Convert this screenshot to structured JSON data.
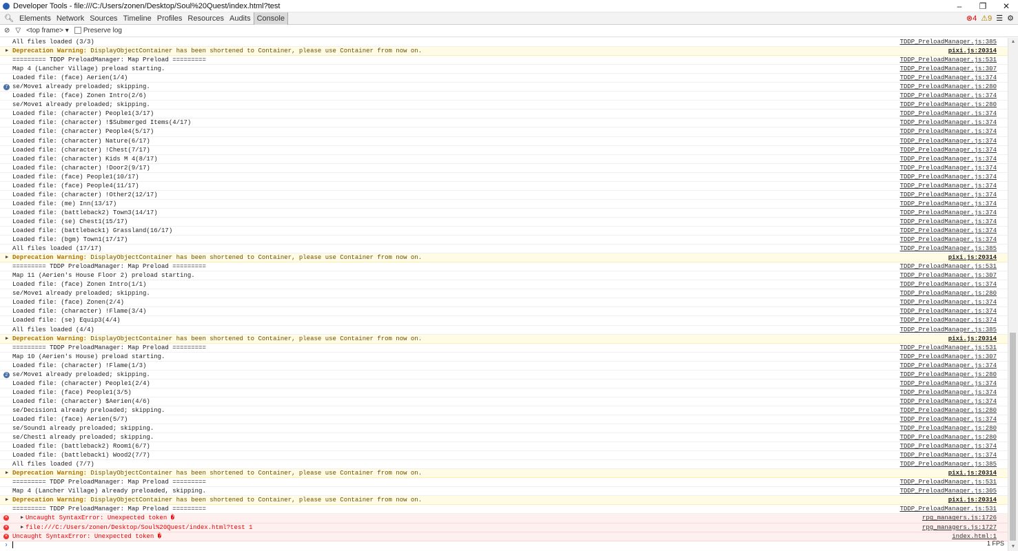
{
  "window": {
    "title": "Developer Tools - file:///C:/Users/zonen/Desktop/Soul%20Quest/index.html?test",
    "minimize": "–",
    "restore": "❐",
    "close": "✕"
  },
  "tabs": [
    "Elements",
    "Network",
    "Sources",
    "Timeline",
    "Profiles",
    "Resources",
    "Audits",
    "Console"
  ],
  "status": {
    "errors": "4",
    "warnings": "9"
  },
  "toolbar": {
    "frame": "<top frame>",
    "preserve_log": "Preserve log"
  },
  "rows": [
    {
      "type": "log",
      "msg": "All files loaded (3/3)",
      "src": "TDDP_PreloadManager.js:385"
    },
    {
      "type": "warn",
      "label": "Deprecation Warning:",
      "msg": " DisplayObjectContainer has been shortened to Container, please use Container from now on.",
      "src": "pixi.js:20314"
    },
    {
      "type": "log",
      "msg": "========= TDDP PreloadManager: Map Preload =========",
      "src": "TDDP_PreloadManager.js:531"
    },
    {
      "type": "log",
      "msg": "Map 4 (Lancher Village) preload starting.",
      "src": "TDDP_PreloadManager.js:307"
    },
    {
      "type": "log",
      "msg": "Loaded file: (face) Aerien(1/4)",
      "src": "TDDP_PreloadManager.js:374"
    },
    {
      "type": "log",
      "badge": "7",
      "msg": "se/Move1 already preloaded; skipping.",
      "src": "TDDP_PreloadManager.js:280"
    },
    {
      "type": "log",
      "msg": "Loaded file: (face) Zonen Intro(2/6)",
      "src": "TDDP_PreloadManager.js:374"
    },
    {
      "type": "log",
      "msg": "se/Move1 already preloaded; skipping.",
      "src": "TDDP_PreloadManager.js:280"
    },
    {
      "type": "log",
      "msg": "Loaded file: (character) People1(3/17)",
      "src": "TDDP_PreloadManager.js:374"
    },
    {
      "type": "log",
      "msg": "Loaded file: (character) !$Submerged Items(4/17)",
      "src": "TDDP_PreloadManager.js:374"
    },
    {
      "type": "log",
      "msg": "Loaded file: (character) People4(5/17)",
      "src": "TDDP_PreloadManager.js:374"
    },
    {
      "type": "log",
      "msg": "Loaded file: (character) Nature(6/17)",
      "src": "TDDP_PreloadManager.js:374"
    },
    {
      "type": "log",
      "msg": "Loaded file: (character) !Chest(7/17)",
      "src": "TDDP_PreloadManager.js:374"
    },
    {
      "type": "log",
      "msg": "Loaded file: (character) Kids M 4(8/17)",
      "src": "TDDP_PreloadManager.js:374"
    },
    {
      "type": "log",
      "msg": "Loaded file: (character) !Door2(9/17)",
      "src": "TDDP_PreloadManager.js:374"
    },
    {
      "type": "log",
      "msg": "Loaded file: (face) People1(10/17)",
      "src": "TDDP_PreloadManager.js:374"
    },
    {
      "type": "log",
      "msg": "Loaded file: (face) People4(11/17)",
      "src": "TDDP_PreloadManager.js:374"
    },
    {
      "type": "log",
      "msg": "Loaded file: (character) !Other2(12/17)",
      "src": "TDDP_PreloadManager.js:374"
    },
    {
      "type": "log",
      "msg": "Loaded file: (me) Inn(13/17)",
      "src": "TDDP_PreloadManager.js:374"
    },
    {
      "type": "log",
      "msg": "Loaded file: (battleback2) Town3(14/17)",
      "src": "TDDP_PreloadManager.js:374"
    },
    {
      "type": "log",
      "msg": "Loaded file: (se) Chest1(15/17)",
      "src": "TDDP_PreloadManager.js:374"
    },
    {
      "type": "log",
      "msg": "Loaded file: (battleback1) Grassland(16/17)",
      "src": "TDDP_PreloadManager.js:374"
    },
    {
      "type": "log",
      "msg": "Loaded file: (bgm) Town1(17/17)",
      "src": "TDDP_PreloadManager.js:374"
    },
    {
      "type": "log",
      "msg": "All files loaded (17/17)",
      "src": "TDDP_PreloadManager.js:385"
    },
    {
      "type": "warn",
      "label": "Deprecation Warning:",
      "msg": " DisplayObjectContainer has been shortened to Container, please use Container from now on.",
      "src": "pixi.js:20314"
    },
    {
      "type": "log",
      "msg": "========= TDDP PreloadManager: Map Preload =========",
      "src": "TDDP_PreloadManager.js:531"
    },
    {
      "type": "log",
      "msg": "Map 11 (Aerien's House Floor 2) preload starting.",
      "src": "TDDP_PreloadManager.js:307"
    },
    {
      "type": "log",
      "msg": "Loaded file: (face) Zonen Intro(1/1)",
      "src": "TDDP_PreloadManager.js:374"
    },
    {
      "type": "log",
      "msg": "se/Move1 already preloaded; skipping.",
      "src": "TDDP_PreloadManager.js:280"
    },
    {
      "type": "log",
      "msg": "Loaded file: (face) Zonen(2/4)",
      "src": "TDDP_PreloadManager.js:374"
    },
    {
      "type": "log",
      "msg": "Loaded file: (character) !Flame(3/4)",
      "src": "TDDP_PreloadManager.js:374"
    },
    {
      "type": "log",
      "msg": "Loaded file: (se) Equip3(4/4)",
      "src": "TDDP_PreloadManager.js:374"
    },
    {
      "type": "log",
      "msg": "All files loaded (4/4)",
      "src": "TDDP_PreloadManager.js:385"
    },
    {
      "type": "warn",
      "label": "Deprecation Warning:",
      "msg": " DisplayObjectContainer has been shortened to Container, please use Container from now on.",
      "src": "pixi.js:20314"
    },
    {
      "type": "log",
      "msg": "========= TDDP PreloadManager: Map Preload =========",
      "src": "TDDP_PreloadManager.js:531"
    },
    {
      "type": "log",
      "msg": "Map 10 (Aerien's House) preload starting.",
      "src": "TDDP_PreloadManager.js:307"
    },
    {
      "type": "log",
      "msg": "Loaded file: (character) !Flame(1/3)",
      "src": "TDDP_PreloadManager.js:374"
    },
    {
      "type": "log",
      "badge": "2",
      "msg": "se/Move1 already preloaded; skipping.",
      "src": "TDDP_PreloadManager.js:280"
    },
    {
      "type": "log",
      "msg": "Loaded file: (character) People1(2/4)",
      "src": "TDDP_PreloadManager.js:374"
    },
    {
      "type": "log",
      "msg": "Loaded file: (face) People1(3/5)",
      "src": "TDDP_PreloadManager.js:374"
    },
    {
      "type": "log",
      "msg": "Loaded file: (character) $Aerien(4/6)",
      "src": "TDDP_PreloadManager.js:374"
    },
    {
      "type": "log",
      "msg": "se/Decision1 already preloaded; skipping.",
      "src": "TDDP_PreloadManager.js:280"
    },
    {
      "type": "log",
      "msg": "Loaded file: (face) Aerien(5/7)",
      "src": "TDDP_PreloadManager.js:374"
    },
    {
      "type": "log",
      "msg": "se/Sound1 already preloaded; skipping.",
      "src": "TDDP_PreloadManager.js:280"
    },
    {
      "type": "log",
      "msg": "se/Chest1 already preloaded; skipping.",
      "src": "TDDP_PreloadManager.js:280"
    },
    {
      "type": "log",
      "msg": "Loaded file: (battleback2) Room1(6/7)",
      "src": "TDDP_PreloadManager.js:374"
    },
    {
      "type": "log",
      "msg": "Loaded file: (battleback1) Wood2(7/7)",
      "src": "TDDP_PreloadManager.js:374"
    },
    {
      "type": "log",
      "msg": "All files loaded (7/7)",
      "src": "TDDP_PreloadManager.js:385"
    },
    {
      "type": "warn",
      "label": "Deprecation Warning:",
      "msg": " DisplayObjectContainer has been shortened to Container, please use Container from now on.",
      "src": "pixi.js:20314"
    },
    {
      "type": "log",
      "msg": "========= TDDP PreloadManager: Map Preload =========",
      "src": "TDDP_PreloadManager.js:531"
    },
    {
      "type": "log",
      "msg": "Map 4 (Lancher Village) already preloaded, skipping.",
      "src": "TDDP_PreloadManager.js:305"
    },
    {
      "type": "warn",
      "label": "Deprecation Warning:",
      "msg": " DisplayObjectContainer has been shortened to Container, please use Container from now on.",
      "src": "pixi.js:20314"
    },
    {
      "type": "log",
      "msg": "========= TDDP PreloadManager: Map Preload =========",
      "src": "TDDP_PreloadManager.js:531"
    },
    {
      "type": "error",
      "indent": true,
      "msg": "Uncaught SyntaxError: Unexpected token �",
      "src": "rpg_managers.js:1726"
    },
    {
      "type": "error",
      "indent": true,
      "msg": "file:///C:/Users/zonen/Desktop/Soul%20Quest/index.html?test 1",
      "src": "rpg_managers.js:1727"
    },
    {
      "type": "error",
      "indent": false,
      "msg": "Uncaught SyntaxError: Unexpected token �",
      "src": "index.html:1"
    }
  ],
  "fps": "1 FPS"
}
